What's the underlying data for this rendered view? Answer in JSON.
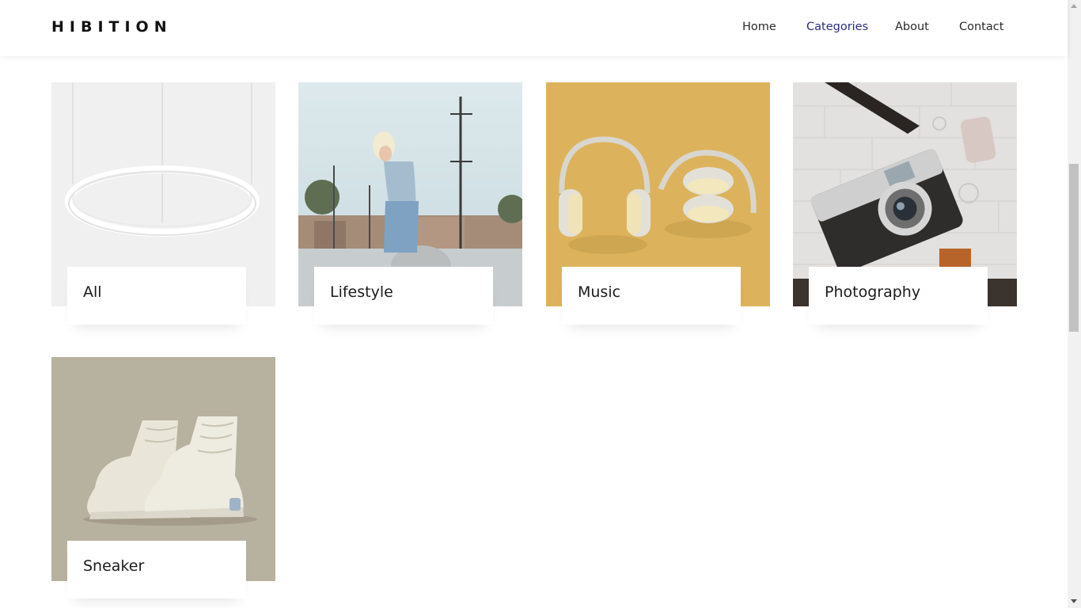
{
  "brand": {
    "name": "HIBITION"
  },
  "nav": {
    "items": [
      {
        "label": "Home"
      },
      {
        "label": "Categories"
      },
      {
        "label": "About"
      },
      {
        "label": "Contact"
      }
    ],
    "active_index": 1
  },
  "categories": [
    {
      "label": "All",
      "image": "pendant-ring-lamp"
    },
    {
      "label": "Lifestyle",
      "image": "woman-denim-jacket-rooftop"
    },
    {
      "label": "Music",
      "image": "headphones-on-yellow"
    },
    {
      "label": "Photography",
      "image": "vintage-camera-film"
    },
    {
      "label": "Sneaker",
      "image": "white-high-top-sneakers"
    }
  ],
  "colors": {
    "nav_active": "#2b2f7a",
    "music_bg": "#dcb35c",
    "sneaker_bg": "#b7b19f",
    "all_bg": "#f0f0f0"
  }
}
